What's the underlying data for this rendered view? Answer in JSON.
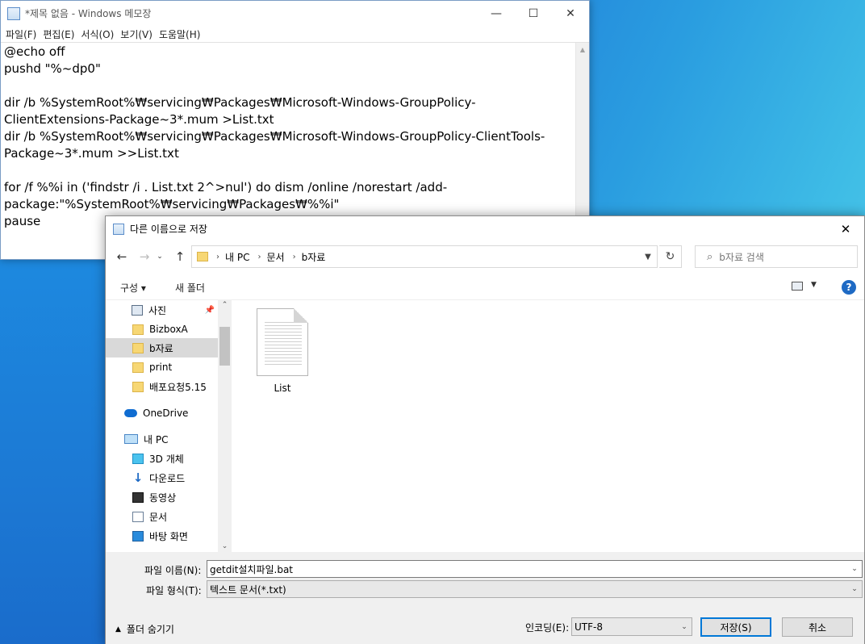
{
  "notepad": {
    "title": "*제목 없음 - Windows 메모장",
    "menu": [
      "파일(F)",
      "편집(E)",
      "서식(O)",
      "보기(V)",
      "도움말(H)"
    ],
    "content": "@echo off\npushd \"%~dp0\"\n\ndir /b %SystemRoot%₩servicing₩Packages₩Microsoft-Windows-GroupPolicy-\nClientExtensions-Package~3*.mum >List.txt\ndir /b %SystemRoot%₩servicing₩Packages₩Microsoft-Windows-GroupPolicy-ClientTools-\nPackage~3*.mum >>List.txt\n\nfor /f %%i in ('findstr /i . List.txt 2^>nul') do dism /online /norestart /add-\npackage:\"%SystemRoot%₩servicing₩Packages₩%%i\"\npause"
  },
  "dialog": {
    "title": "다른 이름으로 저장",
    "breadcrumb": [
      "내 PC",
      "문서",
      "b자료"
    ],
    "search_placeholder": "b자료 검색",
    "toolbar": {
      "organize": "구성 ▾",
      "new_folder": "새 폴더"
    },
    "help": "?",
    "nav_items": [
      {
        "label": "사진",
        "icon": "pictures-icon"
      },
      {
        "label": "BizboxA",
        "icon": "folder-icon"
      },
      {
        "label": "b자료",
        "icon": "folder-icon"
      },
      {
        "label": "print",
        "icon": "folder-icon"
      },
      {
        "label": "배포요청5.15",
        "icon": "folder-icon"
      },
      {
        "label": "OneDrive",
        "icon": "cloud-icon"
      },
      {
        "label": "내 PC",
        "icon": "pc-icon"
      },
      {
        "label": "3D 개체",
        "icon": "cube-icon"
      },
      {
        "label": "다운로드",
        "icon": "download-icon"
      },
      {
        "label": "동영상",
        "icon": "video-icon"
      },
      {
        "label": "문서",
        "icon": "document-icon"
      },
      {
        "label": "바탕 화면",
        "icon": "desktop-icon"
      }
    ],
    "files": [
      {
        "name": "List"
      }
    ],
    "filename_label": "파일 이름(N):",
    "filename_value": "getdit설치파일.bat",
    "filetype_label": "파일 형식(T):",
    "filetype_value": "텍스트 문서(*.txt)",
    "hide_folders": "폴더 숨기기",
    "encoding_label": "인코딩(E):",
    "encoding_value": "UTF-8",
    "save_button": "저장(S)",
    "cancel_button": "취소"
  }
}
